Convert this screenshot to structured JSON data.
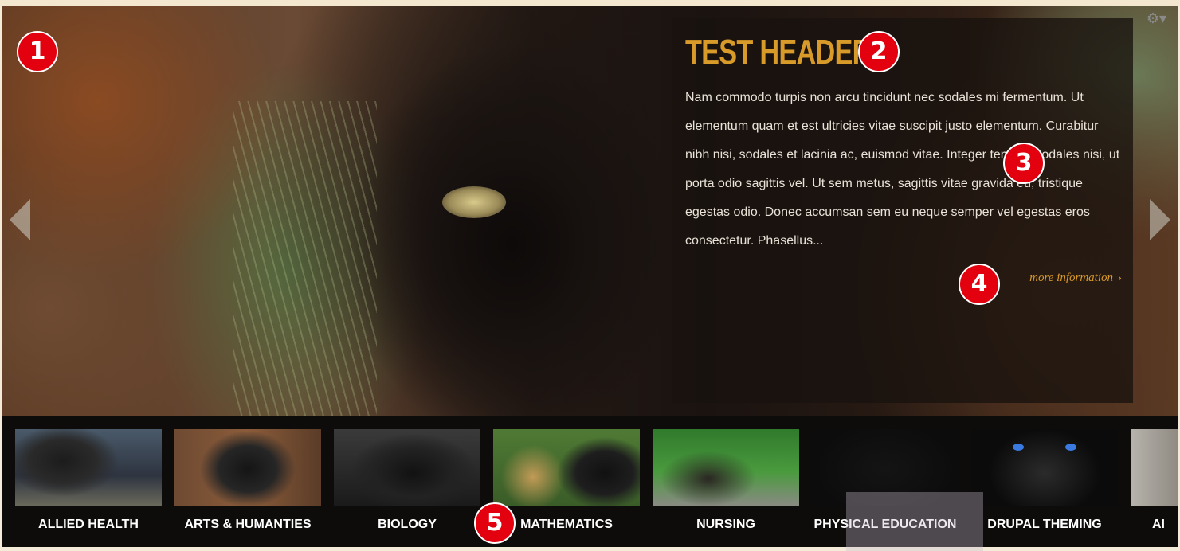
{
  "slide": {
    "title": "TEST HEADER 2",
    "body": "Nam commodo turpis non arcu tincidunt nec sodales mi fermentum. Ut elementum quam et est ultricies vitae suscipit justo elementum. Curabitur nibh nisi, sodales et lacinia ac, euismod vitae. Integer tempus sodales nisi, ut porta odio sagittis vel. Ut sem metus, sagittis vitae gravida eu, tristique egestas odio. Donec accumsan sem eu neque semper vel egestas eros consectetur. Phasellus...",
    "more_link": "more information",
    "more_chevron": "›",
    "gear_icon": "⚙▾"
  },
  "thumbnails": [
    {
      "label": "ALLIED HEALTH"
    },
    {
      "label": "ARTS & HUMANTIES"
    },
    {
      "label": "BIOLOGY"
    },
    {
      "label": "MATHEMATICS"
    },
    {
      "label": "NURSING"
    },
    {
      "label": "PHYSICAL EDUCATION"
    },
    {
      "label": "DRUPAL THEMING"
    },
    {
      "label": "AI"
    }
  ],
  "markers": [
    "1",
    "2",
    "3",
    "4",
    "5"
  ],
  "colors": {
    "accent": "#d89a28",
    "marker": "#e3000f",
    "thumb_bar": "#0d0c0a"
  }
}
